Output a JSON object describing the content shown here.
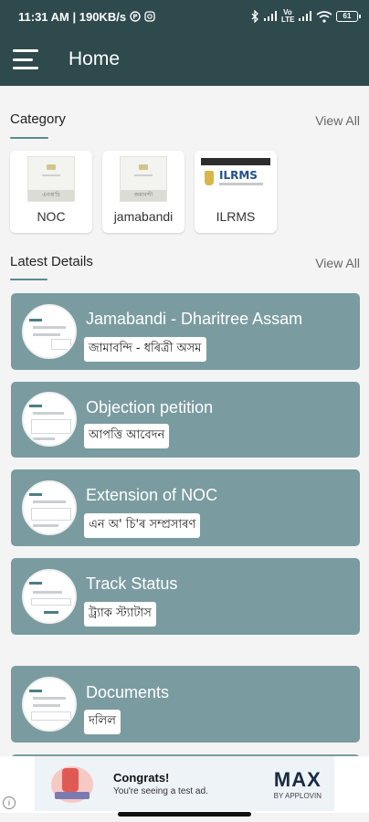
{
  "status_bar": {
    "time_speed": "11:31 AM | 190KB/s",
    "network_labels": "Vo LTE",
    "battery": "61"
  },
  "app_bar": {
    "title": "Home"
  },
  "category": {
    "title": "Category",
    "view_all": "View All",
    "items": [
      {
        "label": "NOC",
        "thumb_caption": "এনঅ'চি"
      },
      {
        "label": "jamabandi",
        "thumb_caption": "জমাবন্দী"
      },
      {
        "label": "ILRMS",
        "thumb_caption": "ILRMS"
      }
    ]
  },
  "latest": {
    "title": "Latest Details",
    "view_all": "View All",
    "items": [
      {
        "title": "Jamabandi - Dharitree Assam",
        "subtitle": "জামাবন্দি - ধৰিত্ৰী অসম"
      },
      {
        "title": "Objection petition",
        "subtitle": "আপত্তি আবেদন"
      },
      {
        "title": "Extension of NOC",
        "subtitle": "এন অ' চি'ৰ সম্প্ৰসাৰণ"
      },
      {
        "title": "Track Status",
        "subtitle": "ট্ৰ্যাক স্ট্যাটাস"
      },
      {
        "title": "Documents",
        "subtitle": "দলিল"
      }
    ]
  },
  "ad": {
    "headline": "Congrats!",
    "subline": "You're seeing a test ad.",
    "brand": "MAX",
    "brand_by": "BY APPLOVIN",
    "info": "i"
  }
}
